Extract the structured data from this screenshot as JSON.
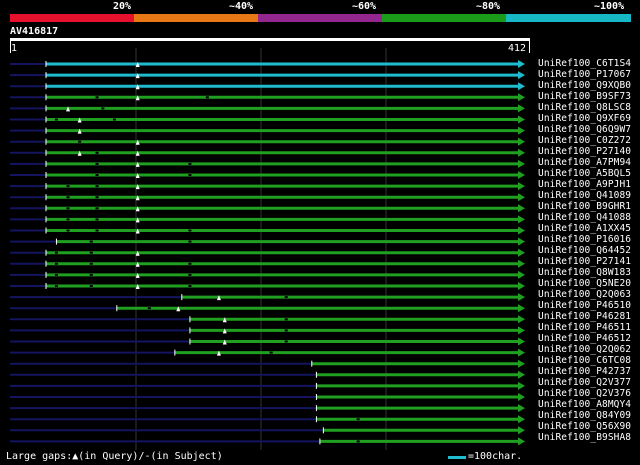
{
  "header": {
    "percent_labels": [
      "20%",
      "~40%",
      "~60%",
      "~80%",
      "~100%"
    ],
    "segment_colors": [
      "#e8112d",
      "#e87715",
      "#93278f",
      "#1a9b1a",
      "#17b8c5"
    ],
    "query_name": "AV416817",
    "ruler_start": "1",
    "ruler_end": "412"
  },
  "colors": {
    "top_hit": "#1fbccf",
    "hit": "#20a020",
    "unaligned": "#141460",
    "gap_marker": "#ffffff"
  },
  "hits": [
    {
      "label": "UniRef100_C6T1S4",
      "start": 1,
      "end": 412,
      "band": 5,
      "gaps": [
        80
      ],
      "pins": []
    },
    {
      "label": "UniRef100_P17067",
      "start": 1,
      "end": 412,
      "band": 5,
      "gaps": [
        80
      ],
      "pins": []
    },
    {
      "label": "UniRef100_Q9XQB0",
      "start": 1,
      "end": 412,
      "band": 5,
      "gaps": [
        80
      ],
      "pins": []
    },
    {
      "label": "UniRef100_B9SF73",
      "start": 1,
      "end": 412,
      "band": 4,
      "gaps": [
        80
      ],
      "pins": [
        45,
        140
      ]
    },
    {
      "label": "UniRef100_Q8LSC8",
      "start": 1,
      "end": 412,
      "band": 4,
      "gaps": [
        20
      ],
      "pins": [
        50
      ]
    },
    {
      "label": "UniRef100_Q9XF69",
      "start": 1,
      "end": 412,
      "band": 4,
      "gaps": [
        30
      ],
      "pins": [
        10,
        60
      ]
    },
    {
      "label": "UniRef100_Q6Q9W7",
      "start": 1,
      "end": 412,
      "band": 4,
      "gaps": [
        30
      ],
      "pins": []
    },
    {
      "label": "UniRef100_C0Z272",
      "start": 1,
      "end": 412,
      "band": 4,
      "gaps": [
        80
      ],
      "pins": [
        30
      ]
    },
    {
      "label": "UniRef100_P27140",
      "start": 1,
      "end": 412,
      "band": 4,
      "gaps": [
        30,
        80
      ],
      "pins": [
        45
      ]
    },
    {
      "label": "UniRef100_A7PM94",
      "start": 1,
      "end": 412,
      "band": 4,
      "gaps": [
        80
      ],
      "pins": [
        45,
        125
      ]
    },
    {
      "label": "UniRef100_A5BQL5",
      "start": 1,
      "end": 412,
      "band": 4,
      "gaps": [
        80
      ],
      "pins": [
        45,
        125
      ]
    },
    {
      "label": "UniRef100_A9PJH1",
      "start": 1,
      "end": 412,
      "band": 4,
      "gaps": [
        80
      ],
      "pins": [
        20,
        45
      ]
    },
    {
      "label": "UniRef100_Q41089",
      "start": 1,
      "end": 412,
      "band": 4,
      "gaps": [
        80
      ],
      "pins": [
        20,
        45
      ]
    },
    {
      "label": "UniRef100_B9GHR1",
      "start": 1,
      "end": 412,
      "band": 4,
      "gaps": [
        80
      ],
      "pins": [
        20,
        45
      ]
    },
    {
      "label": "UniRef100_Q41088",
      "start": 1,
      "end": 412,
      "band": 4,
      "gaps": [
        80
      ],
      "pins": [
        20,
        45
      ]
    },
    {
      "label": "UniRef100_A1XX45",
      "start": 1,
      "end": 412,
      "band": 4,
      "gaps": [
        80
      ],
      "pins": [
        20,
        45,
        125
      ]
    },
    {
      "label": "UniRef100_P16016",
      "start": 10,
      "end": 412,
      "band": 4,
      "gaps": [],
      "pins": [
        40,
        125
      ]
    },
    {
      "label": "UniRef100_Q64452",
      "start": 1,
      "end": 412,
      "band": 4,
      "gaps": [
        80
      ],
      "pins": [
        10,
        40
      ]
    },
    {
      "label": "UniRef100_P27141",
      "start": 1,
      "end": 412,
      "band": 4,
      "gaps": [
        80
      ],
      "pins": [
        10,
        40,
        125
      ]
    },
    {
      "label": "UniRef100_Q8W183",
      "start": 1,
      "end": 412,
      "band": 4,
      "gaps": [
        80
      ],
      "pins": [
        10,
        40,
        125
      ]
    },
    {
      "label": "UniRef100_Q5NE20",
      "start": 1,
      "end": 412,
      "band": 4,
      "gaps": [
        80
      ],
      "pins": [
        10,
        40,
        125
      ]
    },
    {
      "label": "UniRef100_Q2Q063",
      "start": 118,
      "end": 412,
      "band": 4,
      "gaps": [
        150
      ],
      "pins": [
        208
      ]
    },
    {
      "label": "UniRef100_P46510",
      "start": 62,
      "end": 412,
      "band": 4,
      "gaps": [
        115
      ],
      "pins": [
        90
      ]
    },
    {
      "label": "UniRef100_P46281",
      "start": 125,
      "end": 412,
      "band": 4,
      "gaps": [
        155
      ],
      "pins": [
        208
      ]
    },
    {
      "label": "UniRef100_P46511",
      "start": 125,
      "end": 412,
      "band": 4,
      "gaps": [
        155
      ],
      "pins": [
        208
      ]
    },
    {
      "label": "UniRef100_P46512",
      "start": 125,
      "end": 412,
      "band": 4,
      "gaps": [
        155
      ],
      "pins": [
        208
      ]
    },
    {
      "label": "UniRef100_Q2Q062",
      "start": 112,
      "end": 412,
      "band": 4,
      "gaps": [
        150
      ],
      "pins": [
        195
      ]
    },
    {
      "label": "UniRef100_C6TC08",
      "start": 230,
      "end": 412,
      "band": 4,
      "gaps": [],
      "pins": []
    },
    {
      "label": "UniRef100_P42737",
      "start": 234,
      "end": 412,
      "band": 4,
      "gaps": [],
      "pins": []
    },
    {
      "label": "UniRef100_Q2V377",
      "start": 234,
      "end": 412,
      "band": 4,
      "gaps": [],
      "pins": []
    },
    {
      "label": "UniRef100_Q2V376",
      "start": 234,
      "end": 412,
      "band": 4,
      "gaps": [],
      "pins": []
    },
    {
      "label": "UniRef100_A8MQY4",
      "start": 234,
      "end": 412,
      "band": 4,
      "gaps": [],
      "pins": []
    },
    {
      "label": "UniRef100_Q84Y09",
      "start": 234,
      "end": 412,
      "band": 4,
      "gaps": [],
      "pins": [
        270
      ]
    },
    {
      "label": "UniRef100_Q56X90",
      "start": 240,
      "end": 412,
      "band": 4,
      "gaps": [],
      "pins": []
    },
    {
      "label": "UniRef100_B9SHA8",
      "start": 237,
      "end": 412,
      "band": 4,
      "gaps": [],
      "pins": [
        270
      ]
    }
  ],
  "footer": {
    "gap_legend": "Large gaps:▲(in Query)/-(in Subject)",
    "scale_label": "=100char."
  }
}
